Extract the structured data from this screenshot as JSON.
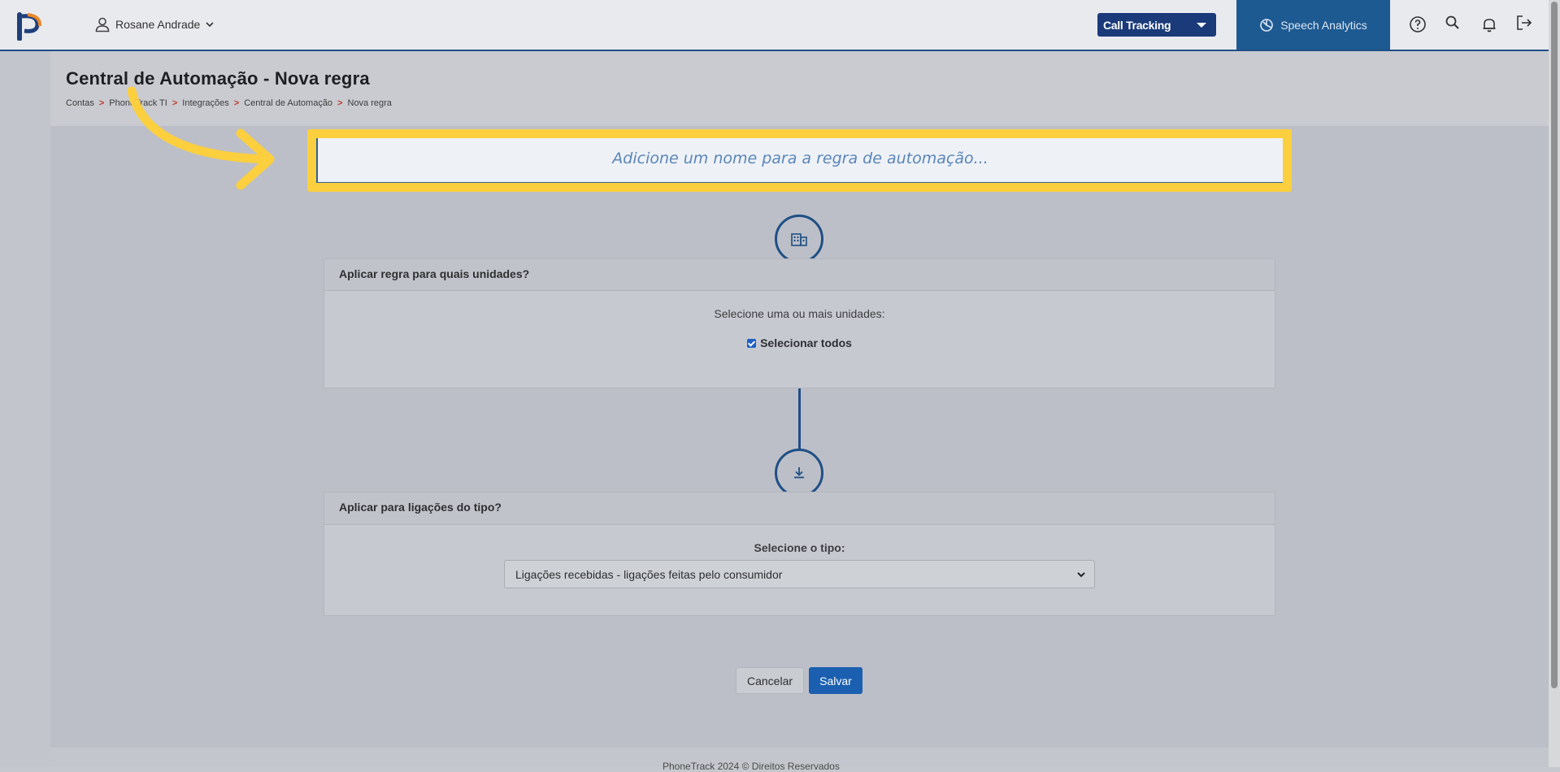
{
  "header": {
    "user_name": "Rosane Andrade",
    "product_select": "Call Tracking",
    "speech_analytics": "Speech Analytics"
  },
  "page": {
    "title": "Central de Automação - Nova regra",
    "breadcrumb": [
      "Contas",
      "PhoneTrack TI",
      "Integrações",
      "Central de Automação",
      "Nova regra"
    ],
    "breadcrumb_sep": ">"
  },
  "rule_name": {
    "placeholder": "Adicione um nome para a regra de automação..."
  },
  "units_card": {
    "title": "Aplicar regra para quais unidades?",
    "subtitle": "Selecione uma ou mais unidades:",
    "select_all_label": "Selecionar todos",
    "select_all_checked": true
  },
  "type_card": {
    "title": "Aplicar para ligações do tipo?",
    "label": "Selecione o tipo:",
    "selected": "Ligações recebidas - ligações feitas pelo consumidor"
  },
  "actions": {
    "cancel": "Cancelar",
    "save": "Salvar"
  },
  "footer": {
    "text": "PhoneTrack 2024 © Direitos Reservados"
  },
  "colors": {
    "primary": "#1f4f86",
    "highlight": "#fccf3f",
    "save_button": "#1b5fb0",
    "breadcrumb_sep": "#c0392b"
  }
}
